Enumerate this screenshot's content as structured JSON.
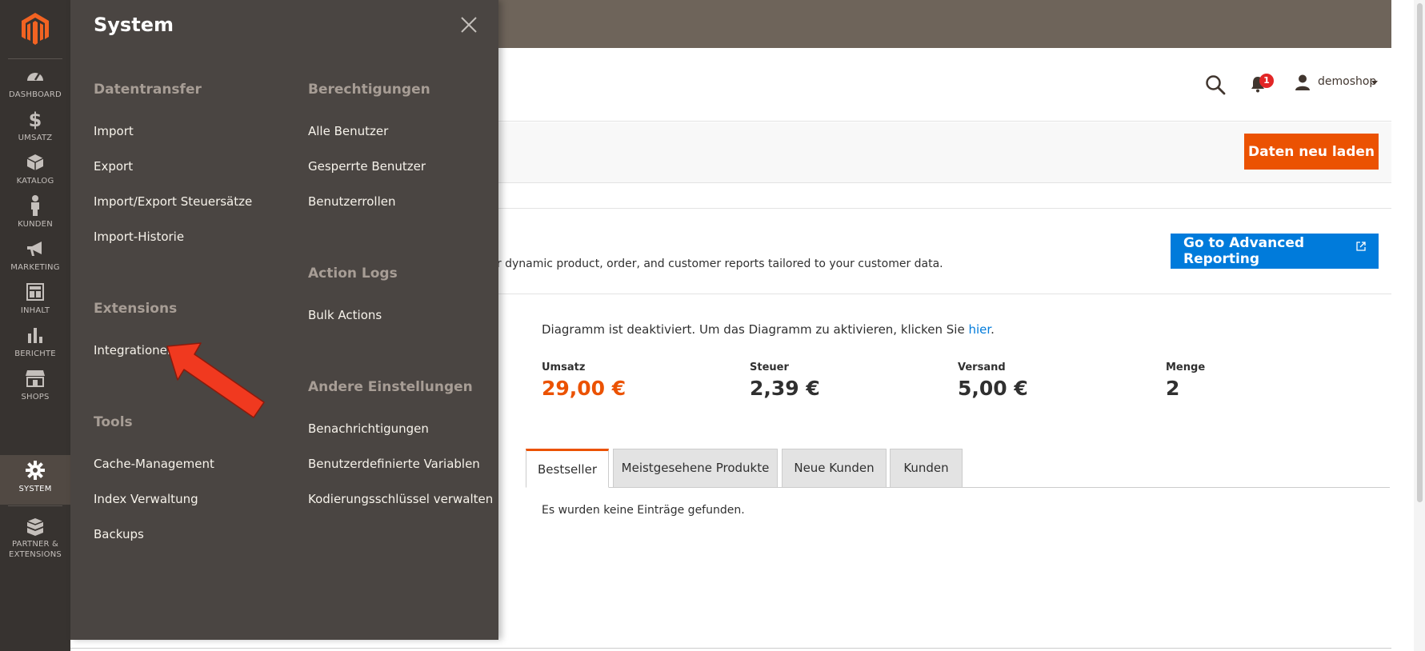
{
  "sidebar": {
    "items": [
      {
        "label": "DASHBOARD",
        "icon": "dashboard-icon"
      },
      {
        "label": "UMSATZ",
        "icon": "dollar-icon"
      },
      {
        "label": "KATALOG",
        "icon": "box-icon"
      },
      {
        "label": "KUNDEN",
        "icon": "person-icon"
      },
      {
        "label": "MARKETING",
        "icon": "megaphone-icon"
      },
      {
        "label": "INHALT",
        "icon": "layout-icon"
      },
      {
        "label": "BERICHTE",
        "icon": "bar-chart-icon"
      },
      {
        "label": "SHOPS",
        "icon": "store-icon"
      },
      {
        "label": "SYSTEM",
        "icon": "gear-icon",
        "active": true
      },
      {
        "label_line1": "PARTNER &",
        "label_line2": "EXTENSIONS",
        "icon": "boxes-icon"
      }
    ]
  },
  "header": {
    "notification_count": "1",
    "user_name": "demoshop"
  },
  "page_actions": {
    "reload_label": "Daten neu laden"
  },
  "advanced_reporting": {
    "description": "ur dynamic product, order, and customer reports tailored to your customer data.",
    "button_label": "Go to Advanced Reporting"
  },
  "dashboard": {
    "chart_notice_prefix": "Diagramm ist deaktiviert. Um das Diagramm zu aktivieren, klicken Sie ",
    "chart_notice_link": "hier",
    "chart_notice_suffix": ".",
    "stats": [
      {
        "label": "Umsatz",
        "value": "29,00 €"
      },
      {
        "label": "Steuer",
        "value": "2,39 €"
      },
      {
        "label": "Versand",
        "value": "5,00 €"
      },
      {
        "label": "Menge",
        "value": "2"
      }
    ],
    "tabs": [
      "Bestseller",
      "Meistgesehene Produkte",
      "Neue Kunden",
      "Kunden"
    ],
    "empty_message": "Es wurden keine Einträge gefunden."
  },
  "flyout": {
    "title": "System",
    "sections": [
      {
        "title": "Datentransfer",
        "items": [
          "Import",
          "Export",
          "Import/Export Steuersätze",
          "Import-Historie"
        ]
      },
      {
        "title": "Extensions",
        "items": [
          "Integrationen"
        ]
      },
      {
        "title": "Tools",
        "items": [
          "Cache-Management",
          "Index Verwaltung",
          "Backups"
        ]
      },
      {
        "title": "Berechtigungen",
        "items": [
          "Alle Benutzer",
          "Gesperrte Benutzer",
          "Benutzerrollen"
        ]
      },
      {
        "title": "Action Logs",
        "items": [
          "Bulk Actions"
        ]
      },
      {
        "title": "Andere Einstellungen",
        "items": [
          "Benachrichtigungen",
          "Benutzerdefinierte Variablen",
          "Kodierungsschlüssel verwalten"
        ]
      }
    ]
  },
  "colors": {
    "sidebar_bg": "#373330",
    "flyout_bg": "#4a4542",
    "accent_orange": "#eb5202",
    "accent_blue": "#007bdb",
    "arrow_red": "#f0391f"
  }
}
